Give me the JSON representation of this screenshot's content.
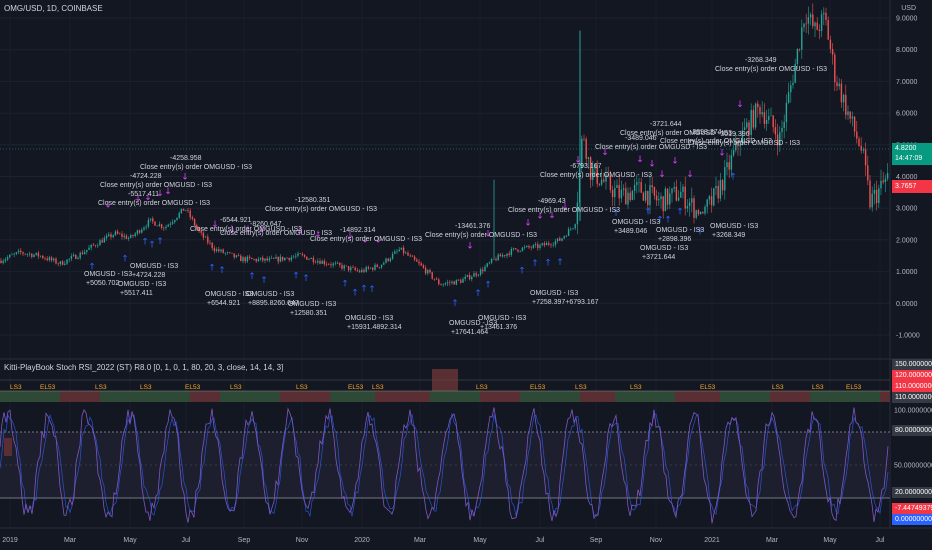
{
  "chart": {
    "title": "OMG/USD, 1D, COINBASE",
    "currency": "USD",
    "price_axis_labels": [
      "9.0000",
      "8.0000",
      "7.0000",
      "6.0000",
      "5.0000",
      "4.0000",
      "3.0000",
      "2.0000",
      "1.0000",
      "0.0000",
      "-1.0000"
    ],
    "current_price": "4.8200",
    "countdown": "14:47:09",
    "alt_price": "3.7657",
    "time_axis_labels": [
      "2019",
      "Mar",
      "May",
      "Jul",
      "Sep",
      "Nov",
      "2020",
      "Mar",
      "May",
      "Jul",
      "Sep",
      "Nov",
      "2021",
      "Mar",
      "May",
      "Jul"
    ]
  },
  "trade_annotations": {
    "close_label": "Close entry(s) order OMGUSD - IS3",
    "entry_label": "OMGUSD - IS3",
    "profits_top": [
      "-4258.958",
      "-4724.228",
      "-5517.411",
      "-6544.921",
      "-8260.647",
      "-12580.351",
      "-14892.314",
      "-13461.376",
      "-4969.43",
      "-6793.167",
      "-3489.046",
      "-3721.644",
      "-2898.374",
      "-3019.396",
      "-3268.349"
    ],
    "profits_bottom": [
      "+5050.702",
      "+4724.228",
      "+5517.411",
      "+6544.921",
      "+8895.8260.647",
      "+12580.351",
      "+15931.4892.314",
      "+17641.464",
      "+13461.376",
      "+7258.397+6793.167",
      "+3489.046",
      "+3721.644",
      "+2898.396",
      "+3268.349"
    ]
  },
  "indicator": {
    "title": "Kitti-PlayBook Stoch RSI_2022 (ST) R8.0  [0, 1, 0, 1, 80, 20, 3, close, 14, 14, 3]",
    "band_labels": [
      "150.00000000",
      "120.00000000",
      "110.00000000",
      "110.00000000"
    ],
    "osc_labels": [
      "100.00000000",
      "80.00000000",
      "50.00000000",
      "20.00000000",
      "-7.44749379",
      "0.00000000"
    ],
    "marker_label": "LS3",
    "marker_label_alt": "EL53"
  },
  "colors": {
    "background": "#131722",
    "up": "#26a69a",
    "down": "#ef5350",
    "accent_teal": "#089981",
    "accent_red": "#f23645",
    "accent_blue": "#2962ff",
    "osc_line": "#7e57c2",
    "signal_line": "#2962ff",
    "marker_magenta": "#e040fb",
    "marker_blue": "#2962ff"
  }
}
